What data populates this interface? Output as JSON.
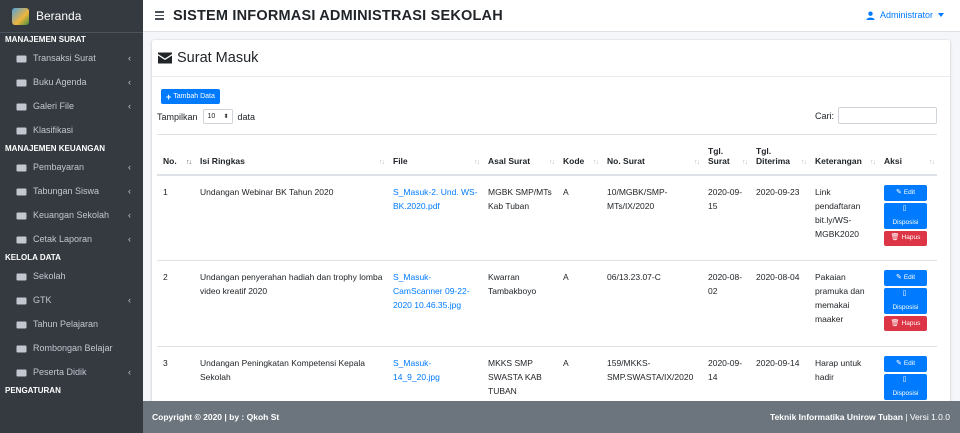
{
  "brand": {
    "title": "Beranda"
  },
  "sidebar": {
    "sections": [
      {
        "header": "MANAJEMEN SURAT",
        "items": [
          {
            "label": "Transaksi Surat",
            "icon": "mail-bulk-icon",
            "chevron": true
          },
          {
            "label": "Buku Agenda",
            "icon": "book-icon",
            "chevron": true
          },
          {
            "label": "Galeri File",
            "icon": "images-icon",
            "chevron": true
          },
          {
            "label": "Klasifikasi",
            "icon": "layers-icon",
            "chevron": false
          }
        ]
      },
      {
        "header": "MANAJEMEN KEUANGAN",
        "items": [
          {
            "label": "Pembayaran",
            "icon": "hand-coin-icon",
            "chevron": true
          },
          {
            "label": "Tabungan Siswa",
            "icon": "wallet-icon",
            "chevron": true
          },
          {
            "label": "Keuangan Sekolah",
            "icon": "coins-icon",
            "chevron": true
          },
          {
            "label": "Cetak Laporan",
            "icon": "print-icon",
            "chevron": true
          }
        ]
      },
      {
        "header": "KELOLA DATA",
        "items": [
          {
            "label": "Sekolah",
            "icon": "school-icon",
            "chevron": false
          },
          {
            "label": "GTK",
            "icon": "teacher-icon",
            "chevron": true
          },
          {
            "label": "Tahun Pelajaran",
            "icon": "calendar-icon",
            "chevron": false
          },
          {
            "label": "Rombongan Belajar",
            "icon": "users-icon",
            "chevron": false
          },
          {
            "label": "Peserta Didik",
            "icon": "student-icon",
            "chevron": true
          }
        ]
      },
      {
        "header": "PENGATURAN",
        "items": []
      }
    ]
  },
  "header": {
    "title": "SISTEM INFORMASI ADMINISTRASI SEKOLAH",
    "user": "Administrator"
  },
  "card": {
    "title": "Surat Masuk"
  },
  "toolbar": {
    "add_label": "Tambah Data",
    "show_prefix": "Tampilkan",
    "show_value": "10",
    "show_suffix": "data",
    "search_label": "Cari:",
    "search_value": ""
  },
  "table": {
    "columns": [
      "No.",
      "Isi Ringkas",
      "File",
      "Asal Surat",
      "Kode",
      "No. Surat",
      "Tgl. Surat",
      "Tgl. Diterima",
      "Keterangan",
      "Aksi"
    ],
    "rows": [
      {
        "no": "1",
        "isi": "Undangan Webinar BK Tahun 2020",
        "file": "S_Masuk-2. Und. WS-BK.2020.pdf",
        "asal": "MGBK SMP/MTs Kab Tuban",
        "kode": "A",
        "nosurat": "10/MGBK/SMP-MTs/IX/2020",
        "tglsurat": "2020-09-15",
        "tglterima": "2020-09-23",
        "ket": "Link pendaftaran bit.ly/WS-MGBK2020"
      },
      {
        "no": "2",
        "isi": "Undangan penyerahan hadiah dan trophy lomba video kreatif 2020",
        "file": "S_Masuk-CamScanner 09-22-2020 10.46.35.jpg",
        "asal": "Kwarran Tambakboyo",
        "kode": "A",
        "nosurat": "06/13.23.07-C",
        "tglsurat": "2020-08-02",
        "tglterima": "2020-08-04",
        "ket": "Pakaian pramuka dan memakai maaker"
      },
      {
        "no": "3",
        "isi": "Undangan Peningkatan Kompetensi Kepala Sekolah",
        "file": "S_Masuk-14_9_20.jpg",
        "asal": "MKKS SMP SWASTA KAB TUBAN",
        "kode": "A",
        "nosurat": "159/MKKS-SMP.SWASTA/IX/2020",
        "tglsurat": "2020-09-14",
        "tglterima": "2020-09-14",
        "ket": "Harap untuk hadir"
      }
    ],
    "actions": {
      "edit": "Edit",
      "disposisi": "Disposisi",
      "hapus": "Hapus"
    }
  },
  "footer": {
    "left": "Copyright © 2020 | by : Qkoh St",
    "right_bold": "Teknik Informatika Unirow Tuban",
    "right_rest": " | Versi 1.0.0"
  }
}
